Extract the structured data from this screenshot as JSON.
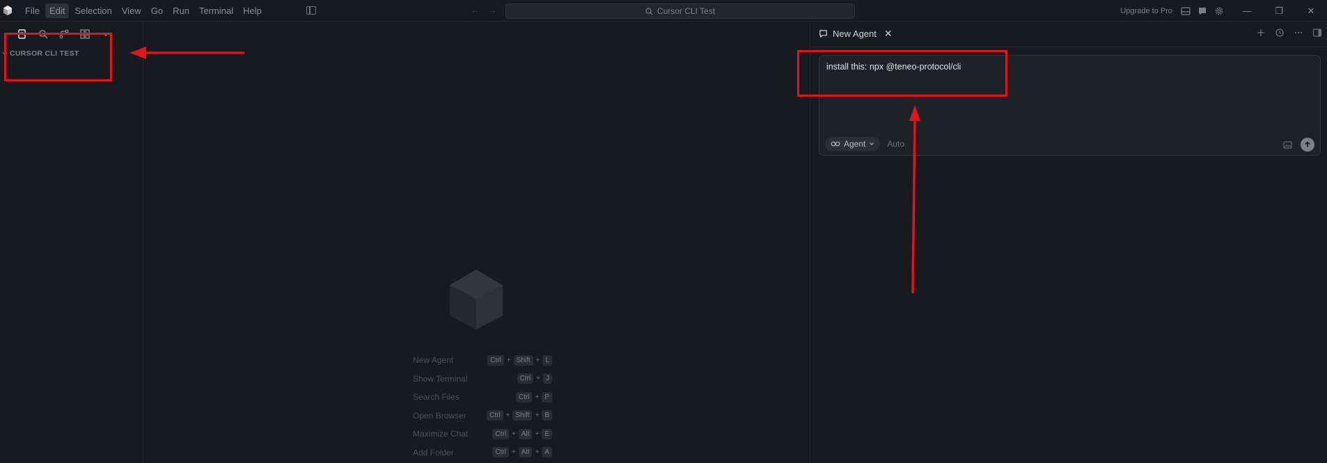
{
  "titlebar": {
    "menu": [
      "File",
      "Edit",
      "Selection",
      "View",
      "Go",
      "Run",
      "Terminal",
      "Help"
    ],
    "active_menu_index": 1,
    "search_text": "Cursor CLI Test",
    "upgrade_label": "Upgrade to Pro",
    "window_controls": [
      "—",
      "❐",
      "✕"
    ]
  },
  "sidebar": {
    "toolbar_icons": [
      "files-icon",
      "search-icon",
      "source-control-icon",
      "extensions-icon",
      "chevron-down-icon"
    ],
    "explorer_title": "CURSOR CLI TEST"
  },
  "editor": {
    "shortcuts": [
      {
        "label": "New Agent",
        "keys": [
          "Ctrl",
          "Shift",
          "L"
        ]
      },
      {
        "label": "Show Terminal",
        "keys": [
          "Ctrl",
          "J"
        ]
      },
      {
        "label": "Search Files",
        "keys": [
          "Ctrl",
          "P"
        ]
      },
      {
        "label": "Open Browser",
        "keys": [
          "Ctrl",
          "Shift",
          "B"
        ]
      },
      {
        "label": "Maximize Chat",
        "keys": [
          "Ctrl",
          "Alt",
          "E"
        ]
      },
      {
        "label": "Add Folder",
        "keys": [
          "Ctrl",
          "Alt",
          "A"
        ]
      }
    ]
  },
  "agent_panel": {
    "tab_label": "New Agent",
    "tab_close": "✕",
    "chat_text": "install this: npx @teneo-protocol/cli",
    "mode_label": "Agent",
    "model_label": "Auto"
  },
  "colors": {
    "annotation": "#e0141e",
    "background": "#181a1f"
  }
}
